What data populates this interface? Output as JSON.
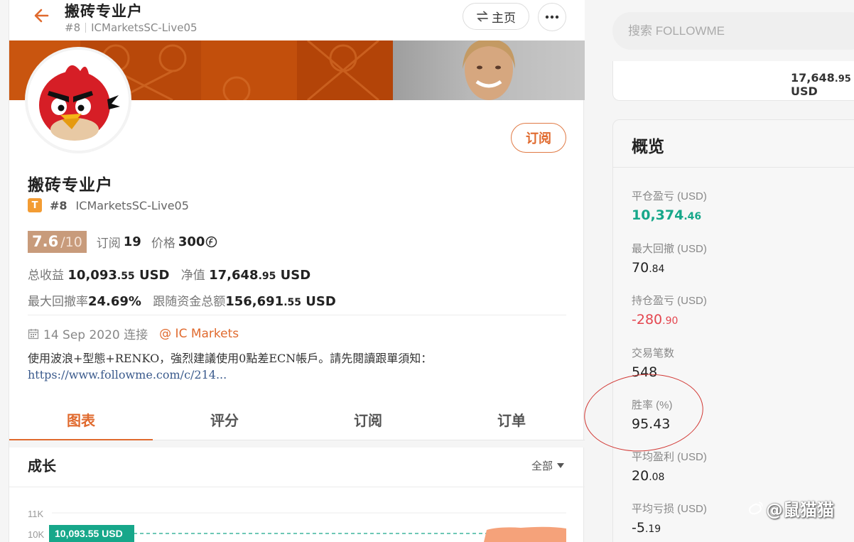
{
  "header": {
    "title": "搬砖专业户",
    "rank": "#8",
    "account": "ICMarketsSC-Live05",
    "home_label": "主页"
  },
  "profile": {
    "name": "搬砖专业户",
    "badge": "T",
    "rank": "#8",
    "account": "ICMarketsSC-Live05",
    "subscribe_label": "订阅",
    "score": "7.6",
    "score_den": "/10",
    "subs_label": "订阅",
    "subs_value": "19",
    "price_label": "价格",
    "price_value": "300",
    "total_profit_label": "总收益",
    "total_profit_main": "10,093",
    "total_profit_dec": ".55",
    "total_profit_unit": " USD",
    "equity_label": "净值",
    "equity_main": "17,648",
    "equity_dec": ".95",
    "equity_unit": " USD",
    "max_dd_label": "最大回撤率",
    "max_dd_value": "24.69%",
    "follow_label": "跟随资金总额",
    "follow_main": "156,691",
    "follow_dec": ".55",
    "follow_unit": " USD",
    "date": "14 Sep 2020 连接",
    "broker": "@ IC Markets",
    "description": "使用波浪+型態+RENKO，強烈建議使用0點差ECN帳戶。請先閱讀跟單須知：",
    "link": "https://www.followme.com/c/214..."
  },
  "tabs": [
    {
      "label": "图表"
    },
    {
      "label": "评分"
    },
    {
      "label": "订阅"
    },
    {
      "label": "订单"
    }
  ],
  "growth": {
    "title": "成长",
    "filter": "全部"
  },
  "chart_data": {
    "type": "area",
    "yticks": [
      "11K",
      "10K"
    ],
    "current_label": "10,093.55 USD",
    "current_value": 10093.55
  },
  "search": {
    "placeholder": "搜索 FOLLOWME"
  },
  "equity_card": {
    "main": "17,648",
    "dec": ".95",
    "unit": " USD"
  },
  "overview": {
    "title": "概览",
    "items": [
      {
        "key": "平仓盈亏 (USD)",
        "main": "10,374",
        "dec": ".46",
        "style": "green"
      },
      {
        "key": "最大回撤 (USD)",
        "main": "70",
        "dec": ".84",
        "style": ""
      },
      {
        "key": "持仓盈亏 (USD)",
        "main": "-280",
        "dec": ".90",
        "style": "red"
      },
      {
        "key": "交易笔数",
        "main": "548",
        "dec": "",
        "style": ""
      },
      {
        "key": "胜率 (%)",
        "main": "95.43",
        "dec": "",
        "style": ""
      },
      {
        "key": "平均盈利 (USD)",
        "main": "20",
        "dec": ".08",
        "style": ""
      },
      {
        "key": "平均亏损 (USD)",
        "main": "-5",
        "dec": ".19",
        "style": ""
      }
    ]
  },
  "watermark": "@鼠猫猫",
  "colors": {
    "accent": "#e06a2e",
    "green": "#17a78a",
    "red": "#e4464f",
    "chart_label_bg": "#17a78a",
    "chart_area": "#f5a27a"
  }
}
